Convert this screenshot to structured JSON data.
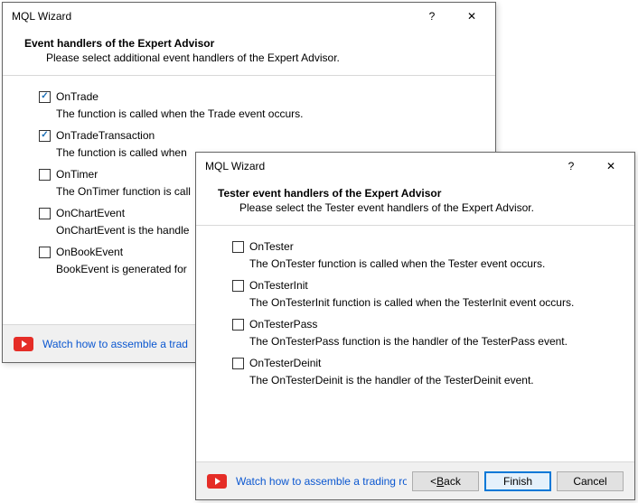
{
  "back": {
    "title": "MQL Wizard",
    "header_title": "Event handlers of the Expert Advisor",
    "header_sub": "Please select additional event handlers of the Expert Advisor.",
    "options": [
      {
        "label": "OnTrade",
        "desc": "The function is called when the Trade event occurs.",
        "checked": true
      },
      {
        "label": "OnTradeTransaction",
        "desc": "The function is called when",
        "checked": true
      },
      {
        "label": "OnTimer",
        "desc": "The OnTimer function is call",
        "checked": false
      },
      {
        "label": "OnChartEvent",
        "desc": "OnChartEvent is the handle",
        "checked": false
      },
      {
        "label": "OnBookEvent",
        "desc": "BookEvent is generated for",
        "checked": false
      }
    ],
    "link": "Watch how to assemble a trad"
  },
  "front": {
    "title": "MQL Wizard",
    "header_title": "Tester event handlers of the Expert Advisor",
    "header_sub": "Please select the Tester event handlers of the Expert Advisor.",
    "options": [
      {
        "label": "OnTester",
        "desc": "The OnTester function is called when the Tester event occurs.",
        "checked": false
      },
      {
        "label": "OnTesterInit",
        "desc": "The OnTesterInit function is called when the TesterInit event occurs.",
        "checked": false
      },
      {
        "label": "OnTesterPass",
        "desc": "The OnTesterPass function is the handler of the TesterPass event.",
        "checked": false
      },
      {
        "label": "OnTesterDeinit",
        "desc": "The OnTesterDeinit is the handler of the TesterDeinit event.",
        "checked": false
      }
    ],
    "link": "Watch how to assemble a trading robot",
    "buttons": {
      "back": "Back",
      "finish": "Finish",
      "cancel": "Cancel"
    }
  }
}
